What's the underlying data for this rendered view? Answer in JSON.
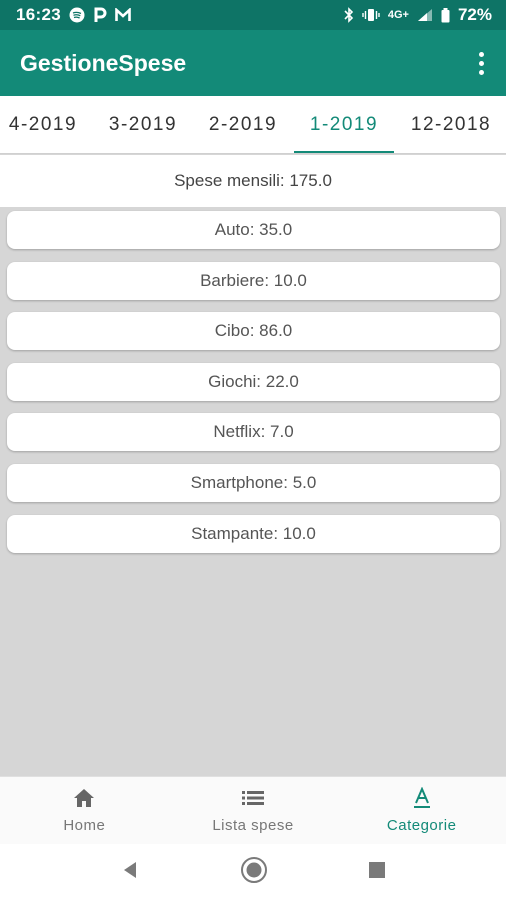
{
  "status_bar": {
    "time": "16:23",
    "left_icons": [
      "spotify-icon",
      "p-icon",
      "gmail-icon"
    ],
    "network": "4G+",
    "battery": "72%"
  },
  "app_bar": {
    "title": "GestioneSpese"
  },
  "tabs": [
    {
      "label": "4-2019",
      "active": false
    },
    {
      "label": "3-2019",
      "active": false
    },
    {
      "label": "2-2019",
      "active": false
    },
    {
      "label": "1-2019",
      "active": true
    },
    {
      "label": "12-2018",
      "active": false
    }
  ],
  "summary": {
    "text": "Spese mensili: 175.0"
  },
  "categories": [
    {
      "label": "Auto: 35.0"
    },
    {
      "label": "Barbiere: 10.0"
    },
    {
      "label": "Cibo: 86.0"
    },
    {
      "label": "Giochi: 22.0"
    },
    {
      "label": "Netflix: 7.0"
    },
    {
      "label": "Smartphone: 5.0"
    },
    {
      "label": "Stampante: 10.0"
    }
  ],
  "bottom_nav": [
    {
      "label": "Home",
      "icon": "home-icon",
      "active": false
    },
    {
      "label": "Lista spese",
      "icon": "list-icon",
      "active": false
    },
    {
      "label": "Categorie",
      "icon": "category-icon",
      "active": true
    }
  ],
  "colors": {
    "primary": "#138a78",
    "primary_dark": "#0e7466",
    "background": "#d6d6d6"
  }
}
